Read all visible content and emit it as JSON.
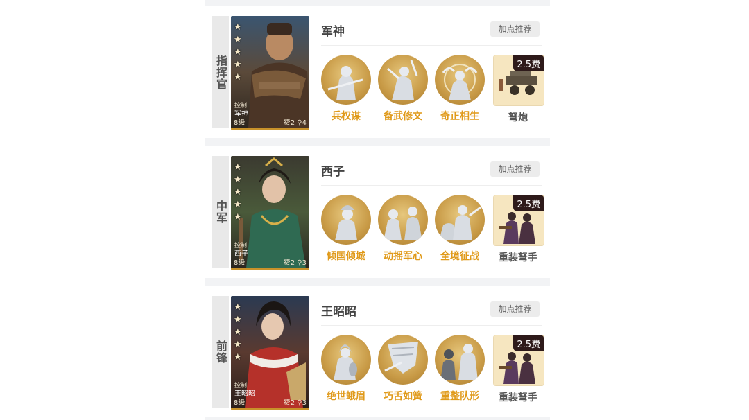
{
  "generals": [
    {
      "role": "指挥官",
      "card_tag": "控制",
      "card_name": "军神",
      "level": "8级",
      "cost_label": "费2",
      "range_label": "4",
      "name": "军神",
      "recommend_label": "加点推荐",
      "skills": [
        {
          "name": "兵权谋",
          "icon": "soldier-sword-icon"
        },
        {
          "name": "备武修文",
          "icon": "sword-strike-icon"
        },
        {
          "name": "奇正相生",
          "icon": "meditating-figure-icon"
        }
      ],
      "troop": {
        "name": "弩炮",
        "cost_badge": "2.5费",
        "icon": "ballista-icon"
      }
    },
    {
      "role": "中军",
      "card_tag": "控制",
      "card_name": "西子",
      "level": "8级",
      "cost_label": "费2",
      "range_label": "3",
      "name": "西子",
      "recommend_label": "加点推荐",
      "skills": [
        {
          "name": "倾国倾城",
          "icon": "lady-portrait-icon"
        },
        {
          "name": "动摇军心",
          "icon": "two-soldiers-icon"
        },
        {
          "name": "全境征战",
          "icon": "charging-army-icon"
        }
      ],
      "troop": {
        "name": "重装弩手",
        "cost_badge": "2.5费",
        "icon": "heavy-crossbowman-icon"
      }
    },
    {
      "role": "前锋",
      "card_tag": "控制",
      "card_name": "王昭昭",
      "level": "8级",
      "cost_label": "费2",
      "range_label": "3",
      "name": "王昭昭",
      "recommend_label": "加点推荐",
      "skills": [
        {
          "name": "绝世蛾眉",
          "icon": "pipa-lady-icon"
        },
        {
          "name": "巧舌如簧",
          "icon": "banner-scroll-icon"
        },
        {
          "name": "重整队形",
          "icon": "armored-guard-icon"
        }
      ],
      "troop": {
        "name": "重装弩手",
        "cost_badge": "2.5费",
        "icon": "heavy-crossbowman-icon"
      }
    }
  ],
  "colors": {
    "skill_label": "#e09a1a",
    "gold_circle": "#c89a46",
    "separator": "#f2f3f5",
    "badge_bg": "#2e1a1a",
    "card_border": "#c8922a"
  }
}
